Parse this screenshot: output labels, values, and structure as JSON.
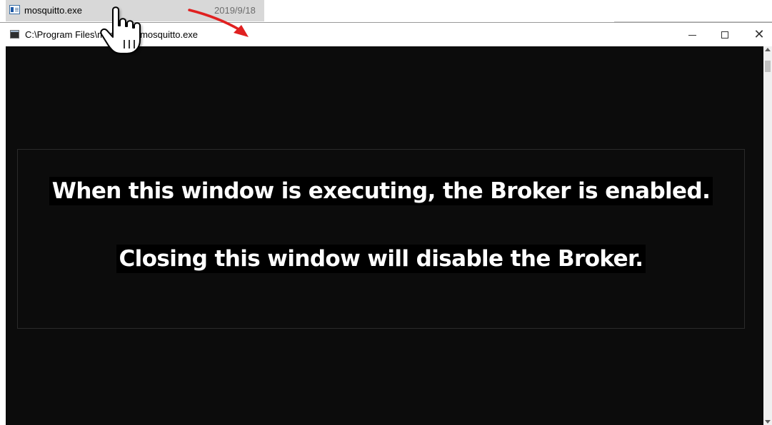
{
  "explorer_row": {
    "file_name": "mosquitto.exe",
    "date": "2019/9/18"
  },
  "console_window": {
    "title": "C:\\Program Files\\mosquitto\\mosquitto.exe",
    "controls": {
      "minimize": "—",
      "maximize": "☐",
      "close": "✕"
    }
  },
  "notice": {
    "line1": "When this window is executing, the Broker is enabled.",
    "line2": "Closing this window will disable the Broker."
  },
  "colors": {
    "console_bg": "#0c0c0c",
    "arrow": "#e02020",
    "selection": "#d8d8d8"
  },
  "icons": [
    "executable-file-icon",
    "console-app-icon",
    "hand-pointer-icon",
    "red-arrow-icon"
  ]
}
